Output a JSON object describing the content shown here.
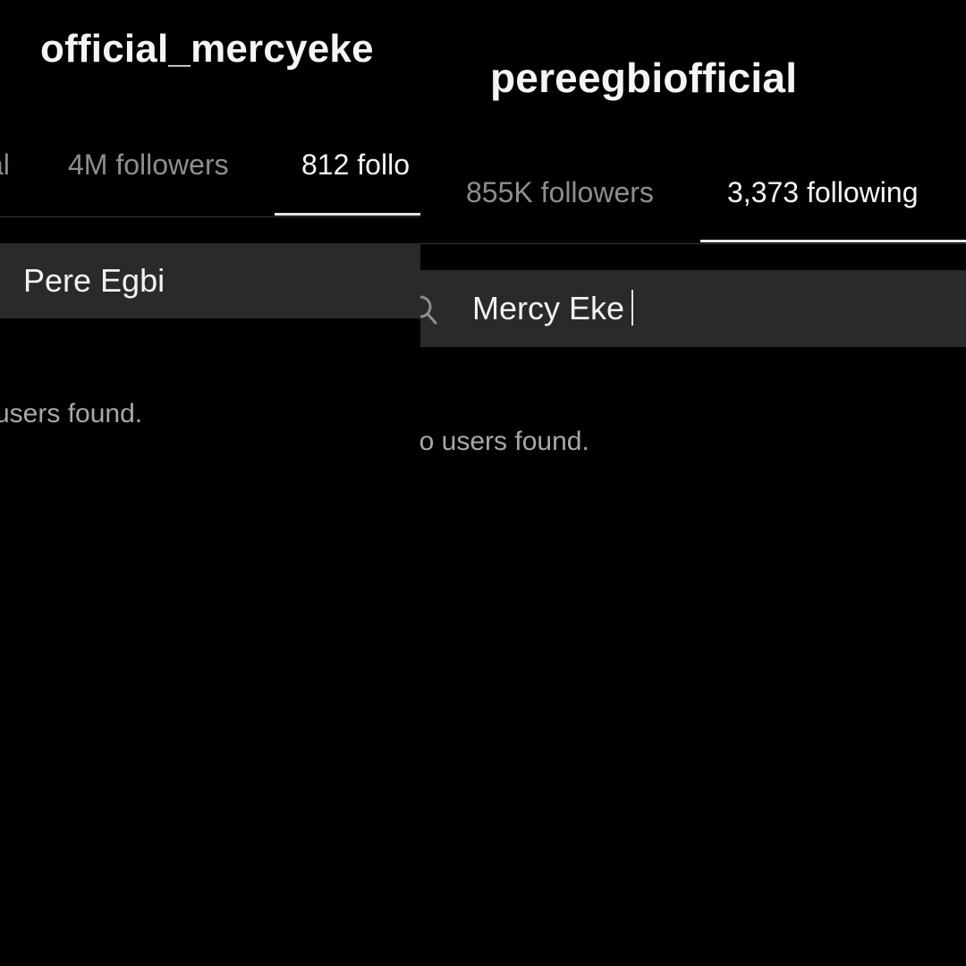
{
  "left_screen": {
    "username": "official_mercyeke",
    "tabs": [
      {
        "label": "al",
        "active": false
      },
      {
        "label": "4M followers",
        "active": false
      },
      {
        "label": "812 follo",
        "active": true
      }
    ],
    "search": {
      "value": "Pere Egbi"
    },
    "empty_message": "users found."
  },
  "right_screen": {
    "username": "pereegbiofficial",
    "tabs": [
      {
        "label": "855K followers",
        "active": false
      },
      {
        "label": "3,373 following",
        "active": true
      }
    ],
    "search": {
      "value": "Mercy Eke",
      "icon": "search-icon"
    },
    "empty_message": "lo users found."
  },
  "colors": {
    "background": "#000000",
    "text_primary": "#f5f5f5",
    "text_secondary": "#8e8e8e",
    "search_bg": "#2a2a2a",
    "underline": "#e8e8e8"
  }
}
